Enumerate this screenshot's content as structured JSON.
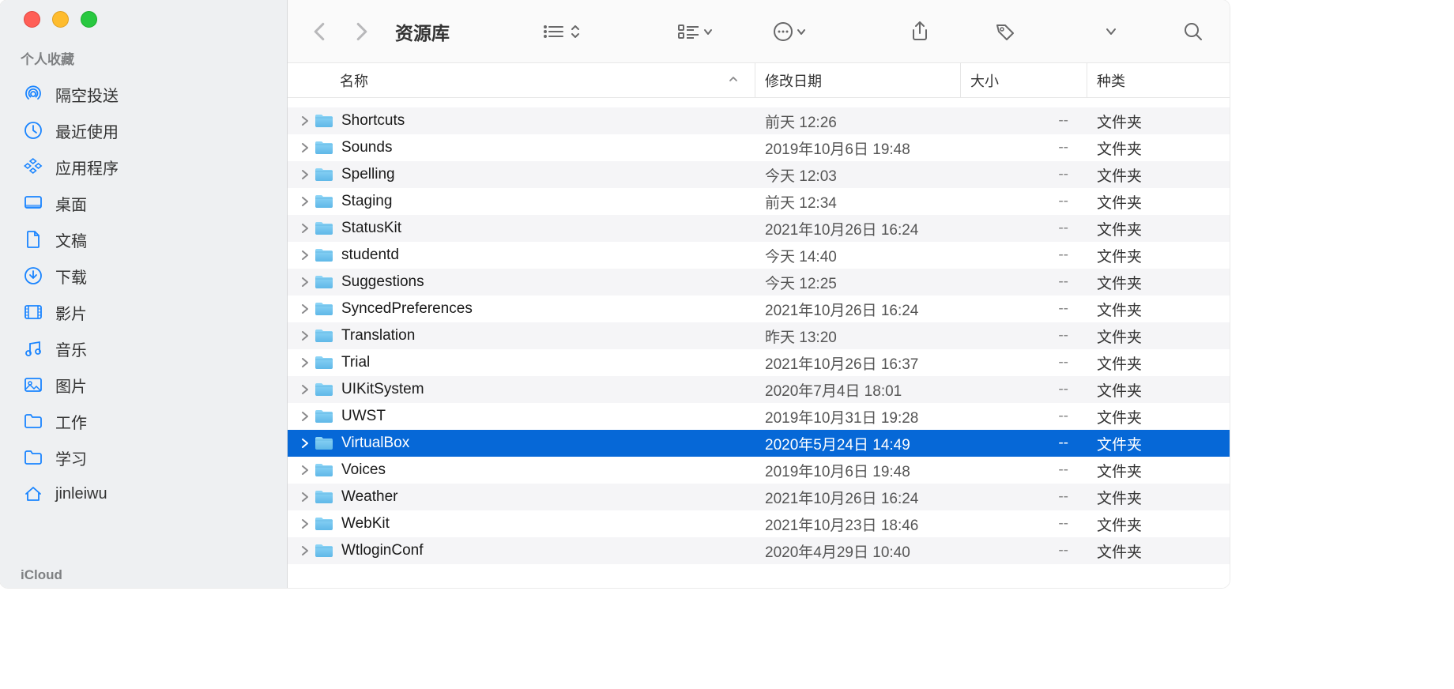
{
  "window": {
    "title": "资源库"
  },
  "sidebar": {
    "section_favorites": "个人收藏",
    "section_icloud": "iCloud",
    "items": [
      {
        "label": "隔空投送",
        "icon": "airdrop"
      },
      {
        "label": "最近使用",
        "icon": "clock"
      },
      {
        "label": "应用程序",
        "icon": "apps"
      },
      {
        "label": "桌面",
        "icon": "desktop"
      },
      {
        "label": "文稿",
        "icon": "documents"
      },
      {
        "label": "下载",
        "icon": "downloads"
      },
      {
        "label": "影片",
        "icon": "movies"
      },
      {
        "label": "音乐",
        "icon": "music"
      },
      {
        "label": "图片",
        "icon": "pictures"
      },
      {
        "label": "工作",
        "icon": "folder"
      },
      {
        "label": "学习",
        "icon": "folder"
      },
      {
        "label": "jinleiwu",
        "icon": "home"
      }
    ]
  },
  "columns": {
    "name": "名称",
    "date": "修改日期",
    "size": "大小",
    "kind": "种类"
  },
  "rows": [
    {
      "name": "",
      "date": "",
      "size": "",
      "kind": "",
      "partial": true
    },
    {
      "name": "Shortcuts",
      "date": "前天 12:26",
      "size": "--",
      "kind": "文件夹"
    },
    {
      "name": "Sounds",
      "date": "2019年10月6日 19:48",
      "size": "--",
      "kind": "文件夹"
    },
    {
      "name": "Spelling",
      "date": "今天 12:03",
      "size": "--",
      "kind": "文件夹"
    },
    {
      "name": "Staging",
      "date": "前天 12:34",
      "size": "--",
      "kind": "文件夹"
    },
    {
      "name": "StatusKit",
      "date": "2021年10月26日 16:24",
      "size": "--",
      "kind": "文件夹"
    },
    {
      "name": "studentd",
      "date": "今天 14:40",
      "size": "--",
      "kind": "文件夹"
    },
    {
      "name": "Suggestions",
      "date": "今天 12:25",
      "size": "--",
      "kind": "文件夹"
    },
    {
      "name": "SyncedPreferences",
      "date": "2021年10月26日 16:24",
      "size": "--",
      "kind": "文件夹"
    },
    {
      "name": "Translation",
      "date": "昨天 13:20",
      "size": "--",
      "kind": "文件夹"
    },
    {
      "name": "Trial",
      "date": "2021年10月26日 16:37",
      "size": "--",
      "kind": "文件夹"
    },
    {
      "name": "UIKitSystem",
      "date": "2020年7月4日 18:01",
      "size": "--",
      "kind": "文件夹"
    },
    {
      "name": "UWST",
      "date": "2019年10月31日 19:28",
      "size": "--",
      "kind": "文件夹"
    },
    {
      "name": "VirtualBox",
      "date": "2020年5月24日 14:49",
      "size": "--",
      "kind": "文件夹",
      "selected": true
    },
    {
      "name": "Voices",
      "date": "2019年10月6日 19:48",
      "size": "--",
      "kind": "文件夹"
    },
    {
      "name": "Weather",
      "date": "2021年10月26日 16:24",
      "size": "--",
      "kind": "文件夹"
    },
    {
      "name": "WebKit",
      "date": "2021年10月23日 18:46",
      "size": "--",
      "kind": "文件夹"
    },
    {
      "name": "WtloginConf",
      "date": "2020年4月29日 10:40",
      "size": "--",
      "kind": "文件夹"
    }
  ]
}
